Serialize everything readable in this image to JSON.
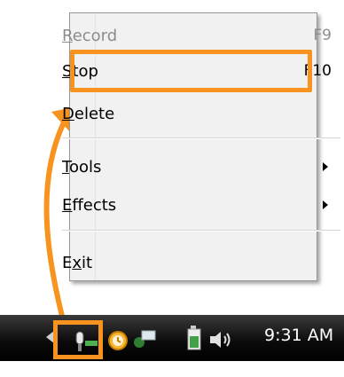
{
  "menu": {
    "items": [
      {
        "id": "record",
        "label": "Record",
        "accelerator": "F9",
        "disabled": true,
        "mnemonic": "R"
      },
      {
        "id": "stop",
        "label": "Stop",
        "accelerator": "F10",
        "disabled": false,
        "mnemonic": "S"
      },
      {
        "id": "delete",
        "label": "Delete",
        "accelerator": "",
        "disabled": false,
        "mnemonic": "D"
      },
      {
        "id": "tools",
        "label": "Tools",
        "accelerator": "",
        "submenu": true,
        "mnemonic": "T"
      },
      {
        "id": "effects",
        "label": "Effects",
        "accelerator": "",
        "submenu": true,
        "mnemonic": "E"
      },
      {
        "id": "exit",
        "label": "Exit",
        "accelerator": "",
        "disabled": false,
        "mnemonic": "x"
      }
    ]
  },
  "highlight_color": "#f7931e",
  "taskbar": {
    "time": "9:31 AM",
    "icons": [
      "microphone-icon",
      "clock-icon",
      "network-icon",
      "battery-icon",
      "volume-icon"
    ]
  }
}
